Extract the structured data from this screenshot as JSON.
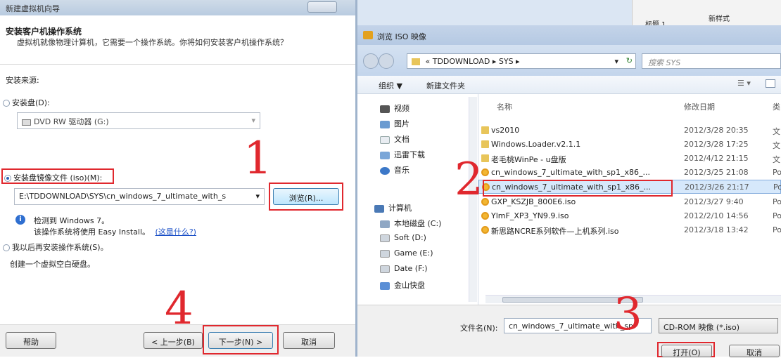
{
  "wizard": {
    "title": "新建虚拟机向导",
    "header_title": "安装客户机操作系统",
    "header_desc": "虚拟机就像物理计算机，它需要一个操作系统。你将如何安装客户机操作系统？",
    "install_from": "安装来源:",
    "disc_option": "安装盘(D):",
    "disc_drive": "DVD RW 驱动器 (G:)",
    "iso_option": "安装盘镜像文件 (iso)(M):",
    "iso_path": "E:\\TDDOWNLOAD\\SYS\\cn_windows_7_ultimate_with_s",
    "browse_button": "浏览(R)...",
    "detected": "检测到 Windows 7。",
    "easy_install": "该操作系统将使用 Easy Install。",
    "what_is": "(这是什么?)",
    "later_option": "我以后再安装操作系统(S)。",
    "later_desc": "创建一个虚拟空白硬盘。",
    "help_button": "帮助",
    "back_button": "< 上一步(B)",
    "next_button": "下一步(N) >",
    "cancel_button": "取消"
  },
  "ribbon": {
    "style_label": "新样式",
    "heading_label": "标题 1"
  },
  "dialog": {
    "title": "浏览 ISO 映像",
    "breadcrumb": [
      "«",
      "TDDOWNLOAD",
      "SYS"
    ],
    "search_placeholder": "搜索 SYS",
    "organize": "组织 ▼",
    "new_folder": "新建文件夹",
    "nav_items": [
      "视频",
      "图片",
      "文档",
      "迅雷下载",
      "音乐",
      "计算机",
      "本地磁盘 (C:)",
      "Soft (D:)",
      "Game (E:)",
      "Date (F:)",
      "金山快盘"
    ],
    "columns": [
      "名称",
      "修改日期",
      "类"
    ],
    "files": [
      {
        "name": "vs2010",
        "date": "2012/3/28 20:35",
        "type": "文",
        "kind": "folder"
      },
      {
        "name": "Windows.Loader.v2.1.1",
        "date": "2012/3/28 17:25",
        "type": "文",
        "kind": "folder"
      },
      {
        "name": "老毛桃WinPe - u盘版",
        "date": "2012/4/12 21:15",
        "type": "文",
        "kind": "folder"
      },
      {
        "name": "cn_windows_7_ultimate_with_sp1_x86_...",
        "date": "2012/3/25 21:08",
        "type": "Po",
        "kind": "iso"
      },
      {
        "name": "cn_windows_7_ultimate_with_sp1_x86_...",
        "date": "2012/3/26 21:17",
        "type": "Po",
        "kind": "iso"
      },
      {
        "name": "GXP_KSZJB_800E6.iso",
        "date": "2012/3/27 9:40",
        "type": "Po",
        "kind": "iso"
      },
      {
        "name": "YlmF_XP3_YN9.9.iso",
        "date": "2012/2/10 14:56",
        "type": "Po",
        "kind": "iso"
      },
      {
        "name": "新思路NCRE系列软件—上机系列.iso",
        "date": "2012/3/18 13:42",
        "type": "Po",
        "kind": "iso"
      }
    ],
    "filename_label": "文件名(N):",
    "filename_value": "cn_windows_7_ultimate_with_sp",
    "filter_value": "CD-ROM 映像 (*.iso)",
    "open_button": "打开(O)",
    "cancel_button": "取消"
  },
  "annotations": [
    "1",
    "2",
    "3",
    "4"
  ]
}
